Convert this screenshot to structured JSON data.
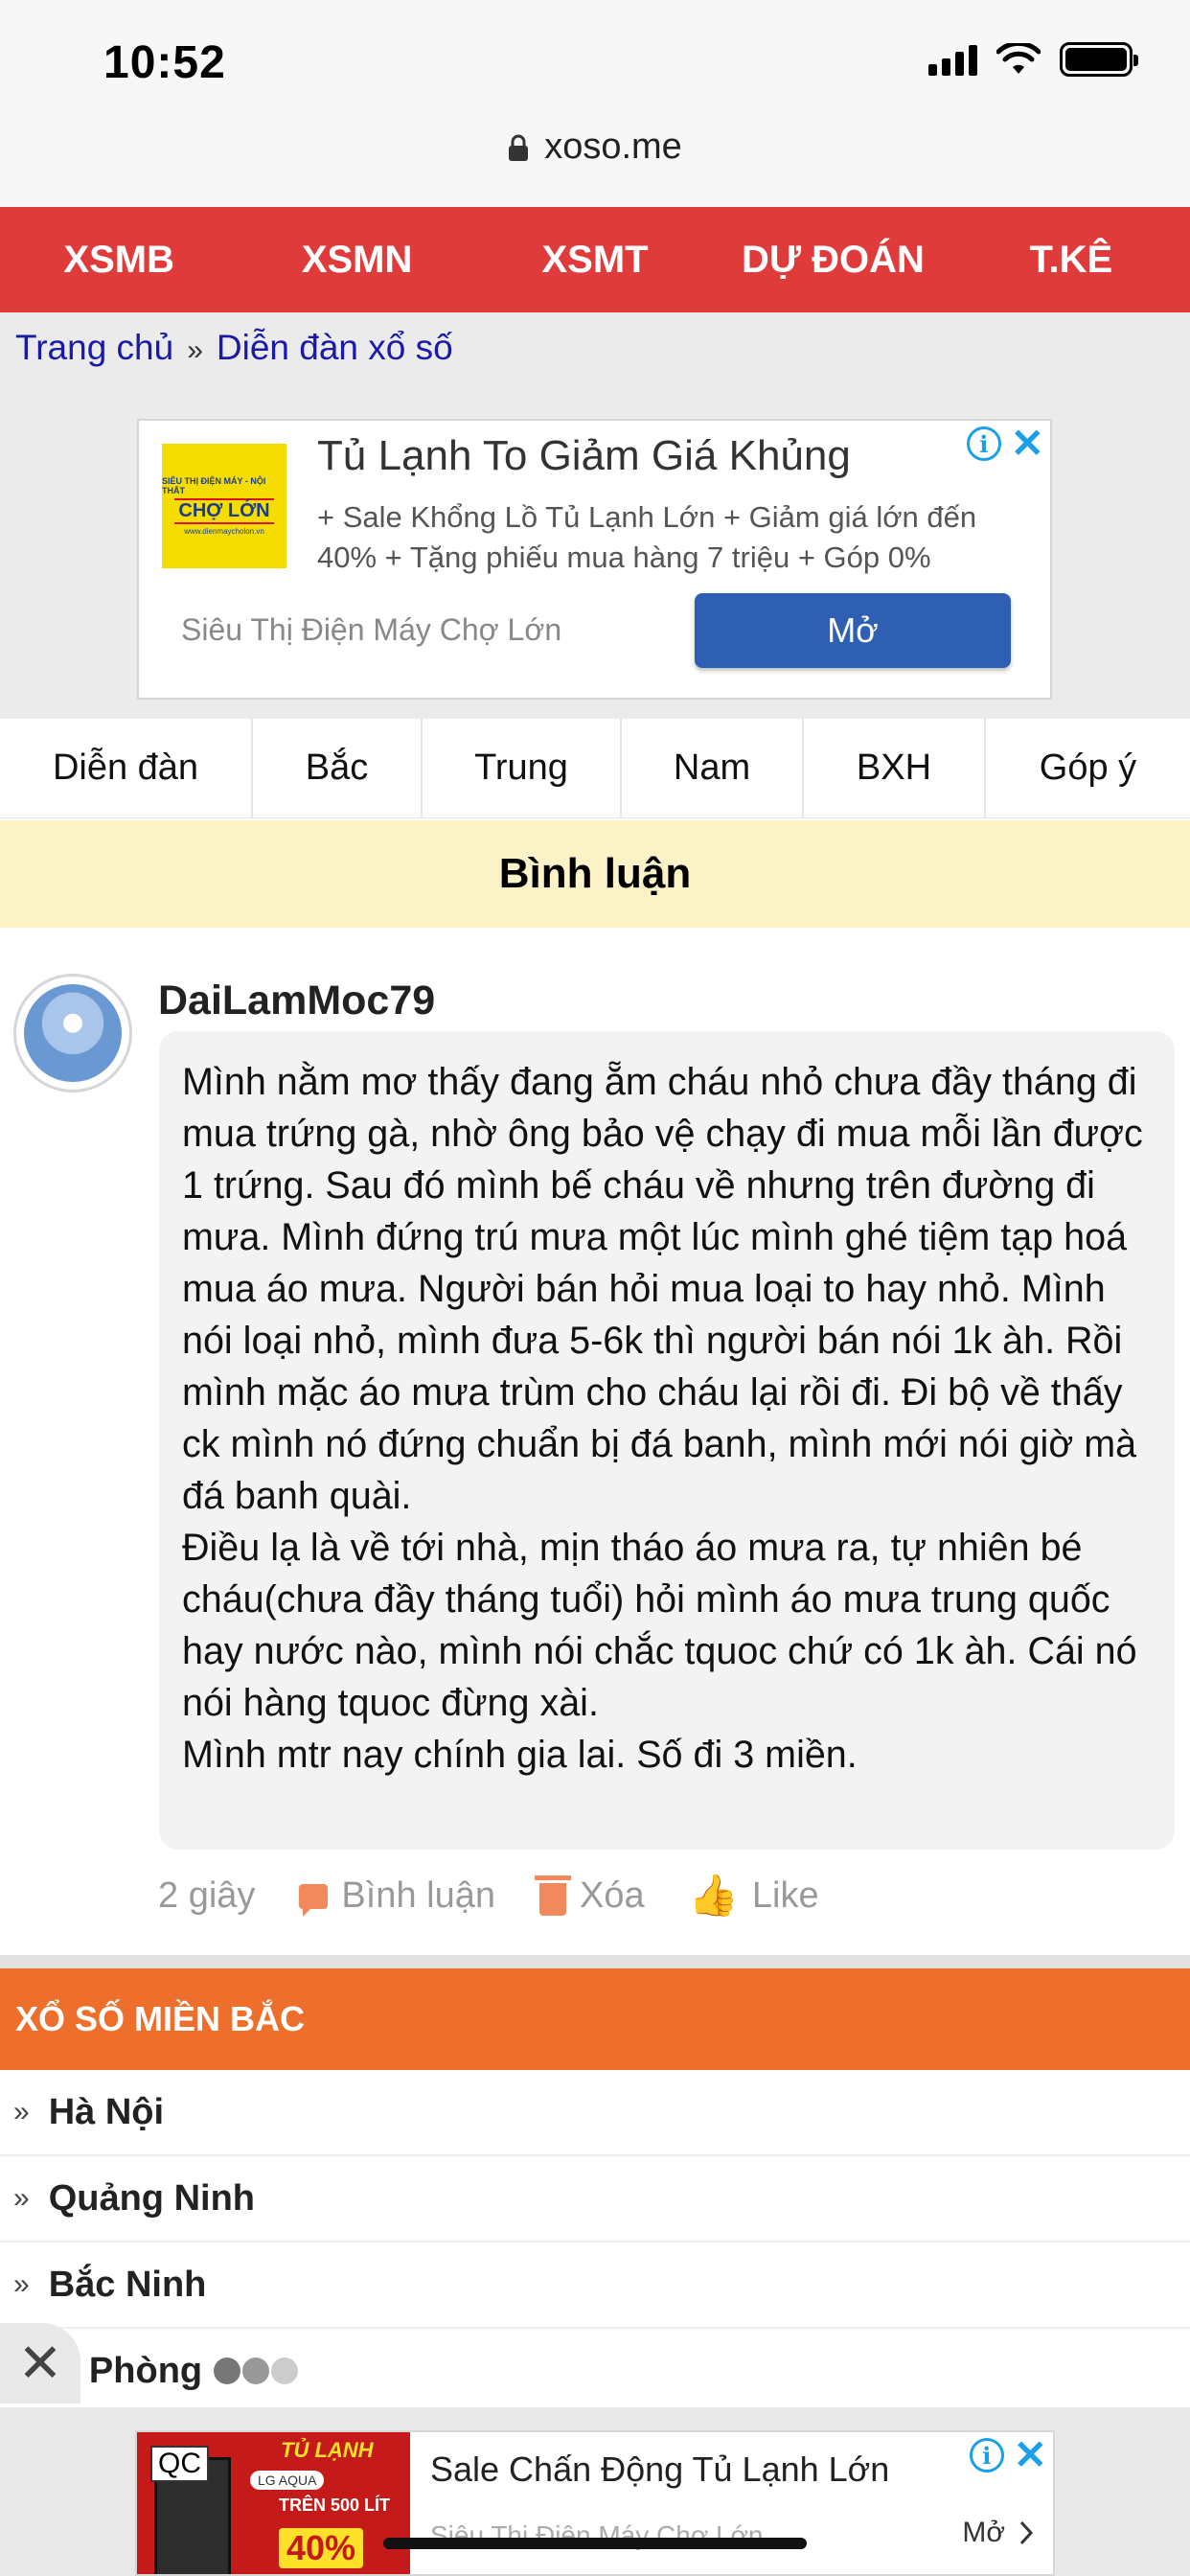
{
  "status": {
    "time": "10:52"
  },
  "browser": {
    "url": "xoso.me"
  },
  "topnav": [
    "XSMB",
    "XSMN",
    "XSMT",
    "DỰ ĐOÁN",
    "T.KÊ"
  ],
  "breadcrumb": {
    "home": "Trang chủ",
    "separator": "»",
    "current": "Diễn đàn xổ số"
  },
  "ad_top": {
    "logo_line1": "SIÊU THỊ ĐIỆN MÁY - NỘI THẤT",
    "logo_brand": "CHỢ LỚN",
    "logo_line3": "www.dienmaycholon.vn",
    "title": "Tủ Lạnh To Giảm Giá Khủng",
    "description": "+ Sale Khổng Lồ Tủ Lạnh Lớn + Giảm giá lớn đến 40% + Tặng phiếu mua hàng 7 triệu + Góp 0%",
    "advertiser": "Siêu Thị Điện Máy Chợ Lớn",
    "cta": "Mở"
  },
  "subnav": [
    "Diễn đàn",
    "Bắc",
    "Trung",
    "Nam",
    "BXH",
    "Góp ý"
  ],
  "section_title": "Bình luận",
  "comment": {
    "username": "DaiLamMoc79",
    "text": "Mình nằm mơ thấy đang ẵm cháu nhỏ chưa đầy tháng đi mua trứng gà, nhờ ông bảo vệ chạy đi mua mỗi lần được 1 trứng. Sau đó mình bế cháu về nhưng trên đường đi mưa. Mình đứng trú mưa một lúc mình ghé tiệm tạp hoá mua áo mưa. Người bán hỏi mua loại to hay nhỏ. Mình nói loại nhỏ, mình đưa 5-6k thì người bán nói 1k àh. Rồi mình mặc áo mưa trùm cho cháu lại rồi đi. Đi bộ về thấy ck mình nó đứng chuẩn bị đá banh, mình mới nói giờ mà đá banh quài.\nĐiều lạ là về tới nhà, mịn tháo áo mưa ra, tự nhiên bé cháu(chưa đầy tháng tuổi) hỏi mình áo mưa trung quốc hay nước nào, mình nói chắc tquoc chứ có 1k àh. Cái nó nói hàng tquoc đừng xài.\nMình mtr nay chính gia lai. Số đi 3 miền.",
    "time": "2 giây",
    "reply_label": "Bình luận",
    "delete_label": "Xóa",
    "like_label": "Like"
  },
  "region": {
    "title": "XỔ SỐ MIỀN BẮC",
    "chevron": "»",
    "provinces": [
      "Hà Nội",
      "Quảng Ninh",
      "Bắc Ninh",
      "ải Phòng"
    ]
  },
  "ad_bottom": {
    "badge": "QC",
    "image_title": "TỦ LẠNH",
    "image_brands": "LG AQUA",
    "image_sub": "TRÊN 500 LÍT",
    "image_discount": "40%",
    "title": "Sale Chấn Động Tủ Lạnh Lớn",
    "advertiser": "Siêu Thị Điện Máy Chợ Lớn",
    "cta": "Mở"
  },
  "icons": {
    "lock": "lock-icon",
    "info": "info-icon",
    "close": "close-icon",
    "reply": "chat-bubble-icon",
    "delete": "trash-icon",
    "like": "thumbs-up-icon"
  },
  "colors": {
    "topnav_bg": "#e03b3b",
    "section_bg": "#fcf2c8",
    "region_bg": "#ee6f2c",
    "link": "#1a1aa6",
    "ad_button": "#2f5fb3"
  }
}
